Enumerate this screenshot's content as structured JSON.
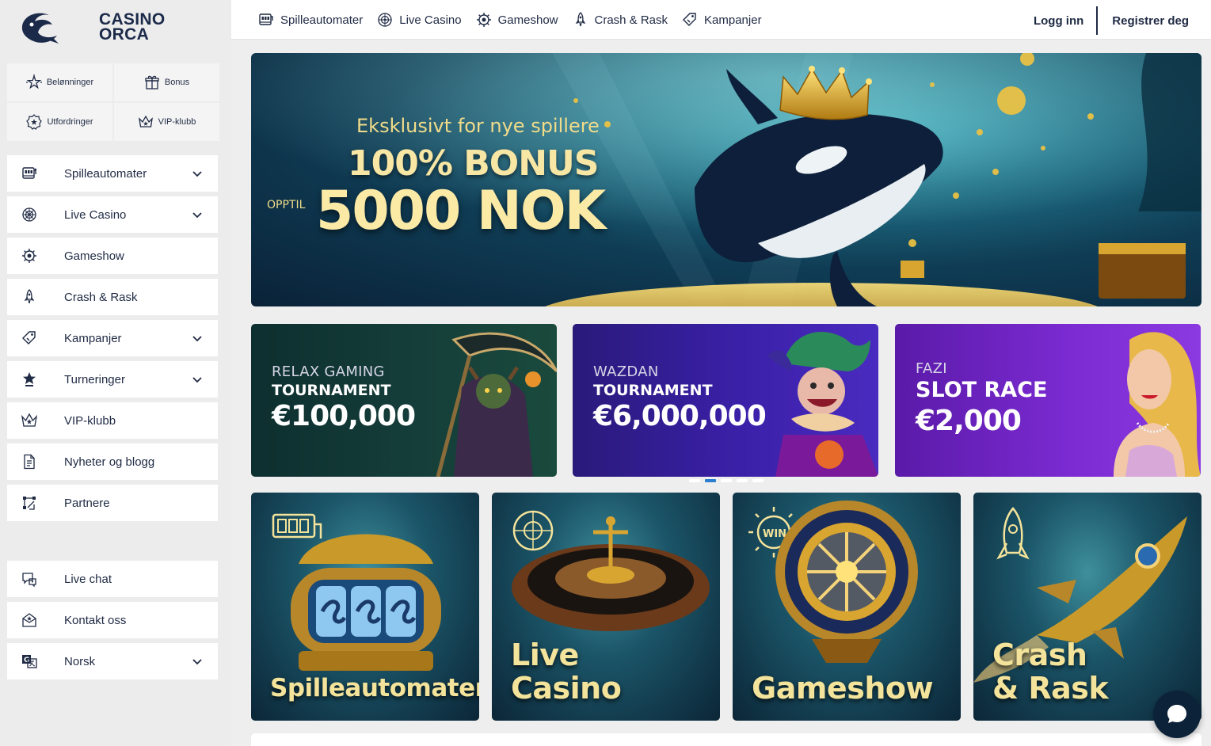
{
  "brand": {
    "name_line1": "CASINO",
    "name_line2": "ORCA"
  },
  "quick_links": [
    {
      "label": "Belønninger",
      "icon": "star-burst-icon"
    },
    {
      "label": "Bonus",
      "icon": "gift-icon"
    },
    {
      "label": "Utfordringer",
      "icon": "badge-star-icon"
    },
    {
      "label": "VIP-klubb",
      "icon": "crown-icon"
    }
  ],
  "sidebar": {
    "items": [
      {
        "label": "Spilleautomater",
        "icon": "slot-machine-icon",
        "has_submenu": true
      },
      {
        "label": "Live Casino",
        "icon": "roulette-icon",
        "has_submenu": true
      },
      {
        "label": "Gameshow",
        "icon": "wheel-icon",
        "has_submenu": false
      },
      {
        "label": "Crash & Rask",
        "icon": "rocket-icon",
        "has_submenu": false
      },
      {
        "label": "Kampanjer",
        "icon": "tag-icon",
        "has_submenu": true
      },
      {
        "label": "Turneringer",
        "icon": "trophy-icon",
        "has_submenu": true
      },
      {
        "label": "VIP-klubb",
        "icon": "crown-icon",
        "has_submenu": false
      },
      {
        "label": "Nyheter og blogg",
        "icon": "document-icon",
        "has_submenu": false
      },
      {
        "label": "Partnere",
        "icon": "partners-icon",
        "has_submenu": false
      }
    ],
    "support": [
      {
        "label": "Live chat",
        "icon": "chat-icon",
        "has_submenu": false
      },
      {
        "label": "Kontakt oss",
        "icon": "mail-icon",
        "has_submenu": false
      },
      {
        "label": "Norsk",
        "icon": "language-icon",
        "has_submenu": true
      }
    ]
  },
  "topnav": [
    {
      "label": "Spilleautomater",
      "icon": "slot-machine-icon"
    },
    {
      "label": "Live Casino",
      "icon": "roulette-icon"
    },
    {
      "label": "Gameshow",
      "icon": "wheel-icon"
    },
    {
      "label": "Crash & Rask",
      "icon": "rocket-icon"
    },
    {
      "label": "Kampanjer",
      "icon": "tag-icon"
    }
  ],
  "auth": {
    "login": "Logg inn",
    "register": "Registrer deg"
  },
  "hero": {
    "subtitle": "Eksklusivt for nye spillere",
    "headline": "100% BONUS",
    "prefix": "OPPTIL",
    "amount": "5000 NOK"
  },
  "promos": [
    {
      "provider": "RELAX GAMING",
      "type": "TOURNAMENT",
      "prize": "€100,000"
    },
    {
      "provider": "WAZDAN",
      "type": "TOURNAMENT",
      "prize": "€6,000,000"
    },
    {
      "provider": "FAZI",
      "type": "SLOT RACE",
      "prize": "€2,000"
    }
  ],
  "carousel": {
    "count": 5,
    "active_index": 1
  },
  "categories": [
    {
      "label": "Spilleautomater"
    },
    {
      "label_line1": "Live",
      "label_line2": "Casino"
    },
    {
      "label": "Gameshow"
    },
    {
      "label_line1": "Crash",
      "label_line2": "& Rask"
    }
  ],
  "colors": {
    "brand_navy": "#1c2a4a",
    "gold": "#f4e39a",
    "accent_blue": "#2a7fd0"
  }
}
